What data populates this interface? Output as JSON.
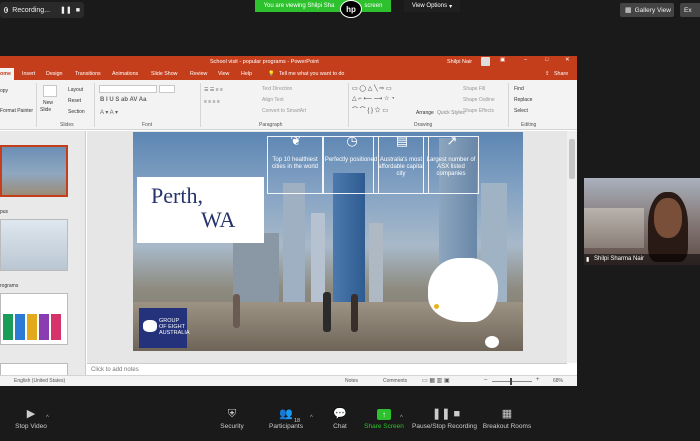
{
  "top": {
    "recording_label": "Recording...",
    "viewing_text": "You are viewing Shilpi Sha",
    "viewing_suffix": "screen",
    "host_logo": "hp",
    "view_options": "View Options",
    "gallery_view": "Gallery View",
    "exit_label": "Ex"
  },
  "ppt": {
    "title": "School visit - popular programs  -  PowerPoint",
    "user": "Shilpi Nair",
    "tabs": [
      "ome",
      "Insert",
      "Design",
      "Transitions",
      "Animations",
      "Slide Show",
      "Review",
      "View",
      "Help",
      "Tell me what you want to do",
      "Share"
    ],
    "ribbon": {
      "clipboard": [
        "opy",
        "Format Painter"
      ],
      "slides": [
        "New",
        "Slide",
        "Layout",
        "Reset",
        "Section"
      ],
      "paragraph": [
        "Text Direction",
        "Align Text",
        "Convert to SmartArt"
      ],
      "drawing": [
        "Arrange",
        "Quick Styles",
        "Shape Fill",
        "Shape Outline",
        "Shape Effects"
      ],
      "editing": [
        "Find",
        "Replace",
        "Select"
      ],
      "groups": [
        "Slides",
        "Font",
        "Paragraph",
        "Drawing",
        "Editing"
      ]
    },
    "left_pane": [
      "pus",
      "rograms"
    ],
    "slide": {
      "title_line1": "Perth,",
      "title_line2": "WA",
      "stats": [
        {
          "icon": "plant-icon",
          "text": "Top 10 healthiest cities in the world"
        },
        {
          "icon": "timer-icon",
          "text": "Perfectly positioned"
        },
        {
          "icon": "card-icon",
          "text": "Australia's most affordable capital city"
        },
        {
          "icon": "growth-chart-icon",
          "text": "Largest number of ASX listed companies"
        }
      ],
      "logo_text": "GROUP OF EIGHT AUSTRALIA"
    },
    "notes_placeholder": "Click to add notes",
    "status": {
      "language": "English (United States)",
      "notes": "Notes",
      "comments": "Comments",
      "zoom": "68%"
    }
  },
  "participant": {
    "name": "Shilpi Sharma Nair"
  },
  "toolbar": {
    "items": [
      "Stop Video",
      "Security",
      "Participants",
      "Chat",
      "Share Screen",
      "Pause/Stop Recording",
      "Breakout Rooms"
    ],
    "participant_count": "18"
  },
  "colors": {
    "ppt_accent": "#c43e1c",
    "zoom_green": "#2ec12e",
    "slide_logo": "#23327a"
  }
}
